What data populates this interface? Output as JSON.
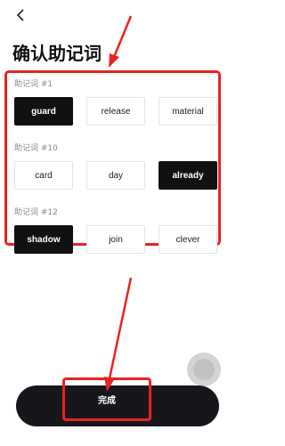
{
  "header": {
    "back_icon": "chevron-left-icon"
  },
  "title": "确认助记词",
  "groups": [
    {
      "label": "助记词 #1",
      "options": [
        {
          "text": "guard",
          "selected": true
        },
        {
          "text": "release",
          "selected": false
        },
        {
          "text": "material",
          "selected": false
        }
      ]
    },
    {
      "label": "助记词 #10",
      "options": [
        {
          "text": "card",
          "selected": false
        },
        {
          "text": "day",
          "selected": false
        },
        {
          "text": "already",
          "selected": true
        }
      ]
    },
    {
      "label": "助记词 #12",
      "options": [
        {
          "text": "shadow",
          "selected": true
        },
        {
          "text": "join",
          "selected": false
        },
        {
          "text": "clever",
          "selected": false
        }
      ]
    }
  ],
  "done_button": "完成",
  "colors": {
    "accent": "#e8231f",
    "primary": "#111111",
    "bar": "#17171b"
  }
}
